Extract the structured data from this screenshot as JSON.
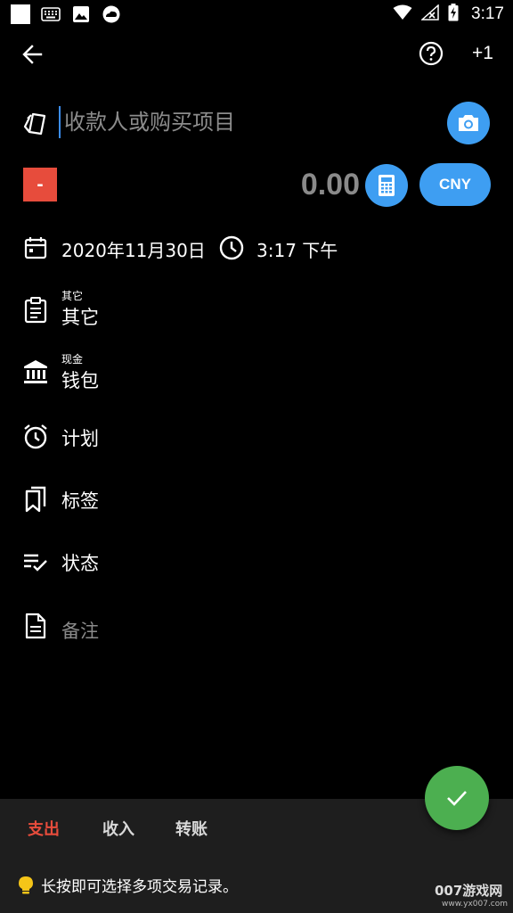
{
  "status_bar": {
    "time": "3:17",
    "icons": [
      "notification-square-icon",
      "keyboard-icon",
      "image-icon",
      "cloud-icon",
      "wifi-icon",
      "no-signal-icon",
      "battery-charging-icon"
    ]
  },
  "app_bar": {
    "back_icon": "arrow-back-icon",
    "help_icon": "help-circle-icon",
    "plus_one_label": "+1"
  },
  "payee": {
    "icon": "cards-icon",
    "placeholder": "收款人或购买项目",
    "value": "",
    "camera_icon": "camera-icon"
  },
  "amount": {
    "sign_label": "-",
    "value": "0.00",
    "calculator_icon": "calculator-icon",
    "currency": "CNY"
  },
  "datetime": {
    "date_icon": "calendar-icon",
    "date": "2020年11月30日",
    "time_icon": "clock-icon",
    "time": "3:17 下午"
  },
  "fields": {
    "category": {
      "icon": "clipboard-icon",
      "small": "其它",
      "main": "其它"
    },
    "account": {
      "icon": "bank-icon",
      "small": "现金",
      "main": "钱包"
    },
    "schedule": {
      "icon": "alarm-icon",
      "main": "计划"
    },
    "tags": {
      "icon": "bookmarks-icon",
      "main": "标签"
    },
    "status": {
      "icon": "list-check-icon",
      "main": "状态"
    },
    "notes": {
      "icon": "document-icon",
      "main": "备注"
    }
  },
  "fab": {
    "icon": "check-icon"
  },
  "bottom": {
    "tabs": [
      {
        "label": "支出",
        "active": true
      },
      {
        "label": "收入",
        "active": false
      },
      {
        "label": "转账",
        "active": false
      }
    ],
    "hint_icon": "lightbulb-icon",
    "hint": "长按即可选择多项交易记录。"
  },
  "watermark": {
    "text": "007游戏网",
    "url": "www.yx007.com"
  },
  "colors": {
    "accent_blue": "#3e9ef2",
    "expense_red": "#e74c3c",
    "fab_green": "#4caf50",
    "background": "#000000",
    "bottom_panel": "#1e1e1e"
  }
}
